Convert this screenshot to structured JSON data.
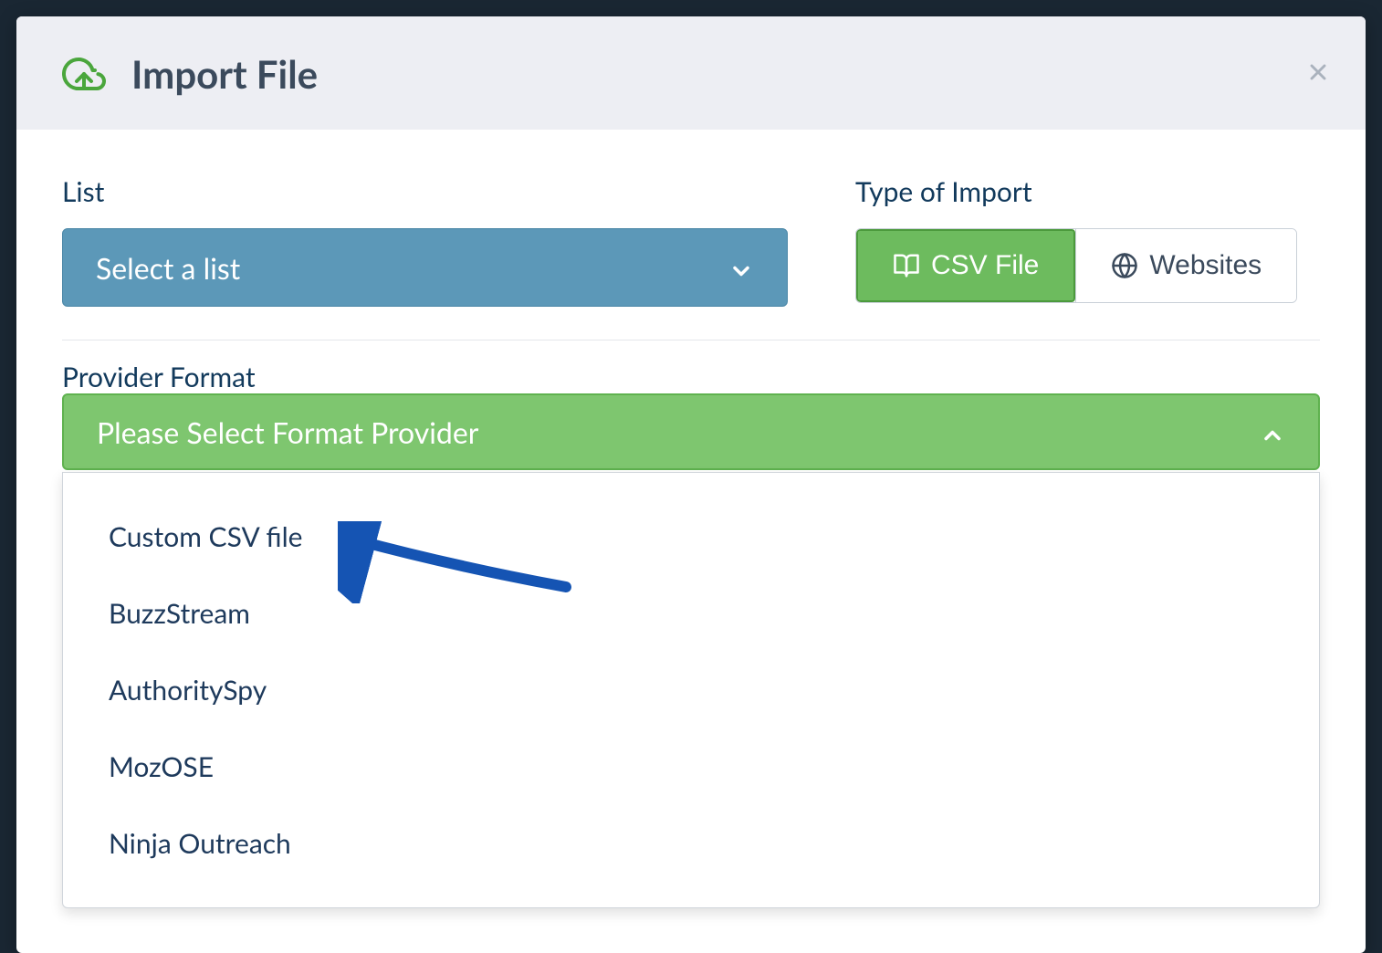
{
  "modal": {
    "title": "Import File"
  },
  "list": {
    "label": "List",
    "placeholder": "Select a list"
  },
  "typeOfImport": {
    "label": "Type of Import",
    "csvLabel": "CSV File",
    "websitesLabel": "Websites"
  },
  "providerFormat": {
    "label": "Provider Format",
    "placeholder": "Please Select Format Provider",
    "options": [
      "Custom CSV file",
      "BuzzStream",
      "AuthoritySpy",
      "MozOSE",
      "Ninja Outreach"
    ]
  },
  "colors": {
    "headerBg": "#edeef3",
    "titleText": "#3b4a5c",
    "listSelectBg": "#5c98b8",
    "activeGreen": "#6dbb5e",
    "providerGreen": "#7ec66f",
    "labelText": "#123a5c",
    "arrowBlue": "#1554b3"
  }
}
